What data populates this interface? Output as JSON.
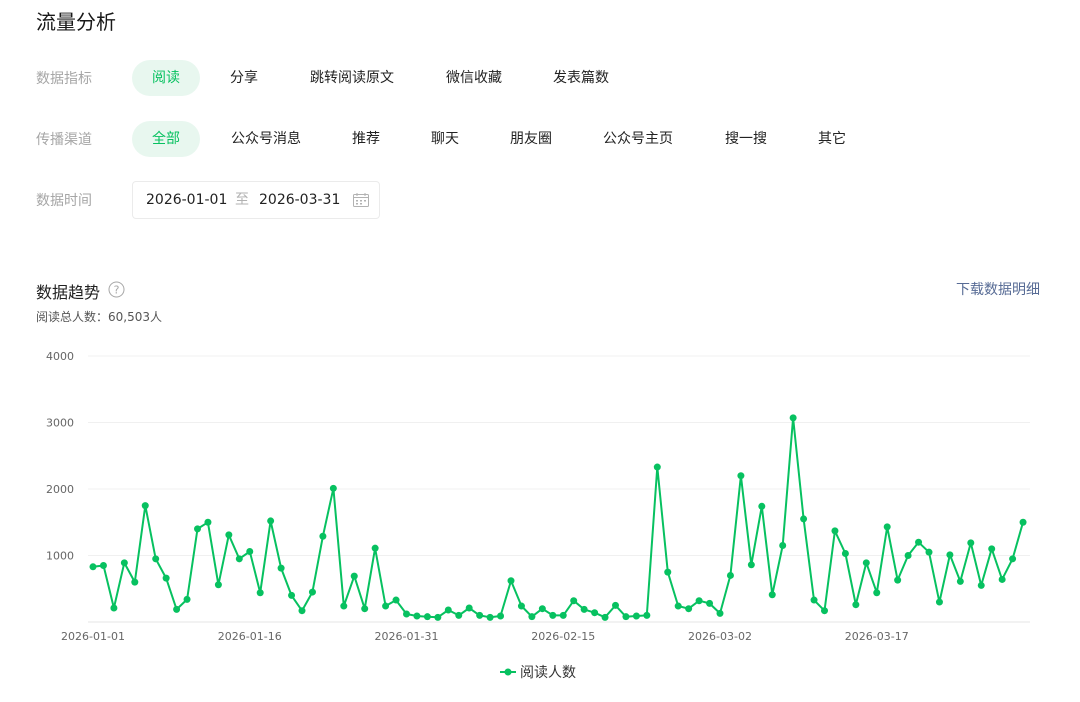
{
  "page": {
    "title": "流量分析"
  },
  "filters": {
    "metric": {
      "label": "数据指标",
      "options": [
        "阅读",
        "分享",
        "跳转阅读原文",
        "微信收藏",
        "发表篇数"
      ],
      "active_index": 0
    },
    "channel": {
      "label": "传播渠道",
      "options": [
        "全部",
        "公众号消息",
        "推荐",
        "聊天",
        "朋友圈",
        "公众号主页",
        "搜一搜",
        "其它"
      ],
      "active_index": 0
    },
    "time": {
      "label": "数据时间",
      "start": "2026-01-01",
      "separator": "至",
      "end": "2026-03-31"
    }
  },
  "trend": {
    "title": "数据趋势",
    "download_label": "下载数据明细",
    "total_label": "阅读总人数：",
    "total_value": "60,503人"
  },
  "colors": {
    "accent": "#07c160",
    "link": "#576b95"
  },
  "chart_data": {
    "type": "line",
    "x_start": "2026-01-01",
    "x_end": "2026-03-31",
    "x_tick_labels": [
      "2026-01-01",
      "2026-01-16",
      "2026-01-31",
      "2026-02-15",
      "2026-03-02",
      "2026-03-17"
    ],
    "ylim": [
      0,
      4000
    ],
    "y_ticks": [
      4000,
      3000,
      2000,
      1000
    ],
    "grid": true,
    "legend_position": "bottom-center",
    "series": [
      {
        "name": "阅读人数",
        "color": "#07c160",
        "values": [
          830,
          850,
          210,
          890,
          600,
          1750,
          950,
          660,
          190,
          340,
          1400,
          1500,
          560,
          1310,
          950,
          1060,
          440,
          1520,
          810,
          400,
          170,
          450,
          1290,
          2010,
          240,
          690,
          200,
          1110,
          240,
          330,
          120,
          90,
          80,
          70,
          180,
          100,
          210,
          100,
          70,
          90,
          620,
          240,
          80,
          200,
          100,
          100,
          320,
          190,
          140,
          70,
          250,
          80,
          90,
          100,
          2330,
          750,
          240,
          200,
          320,
          280,
          130,
          700,
          2200,
          860,
          1740,
          410,
          1150,
          3070,
          1550,
          330,
          170,
          1370,
          1030,
          260,
          890,
          440,
          1430,
          630,
          1000,
          1200,
          1050,
          300,
          1010,
          610,
          1190,
          550,
          1100,
          640,
          950,
          1500
        ]
      }
    ]
  }
}
